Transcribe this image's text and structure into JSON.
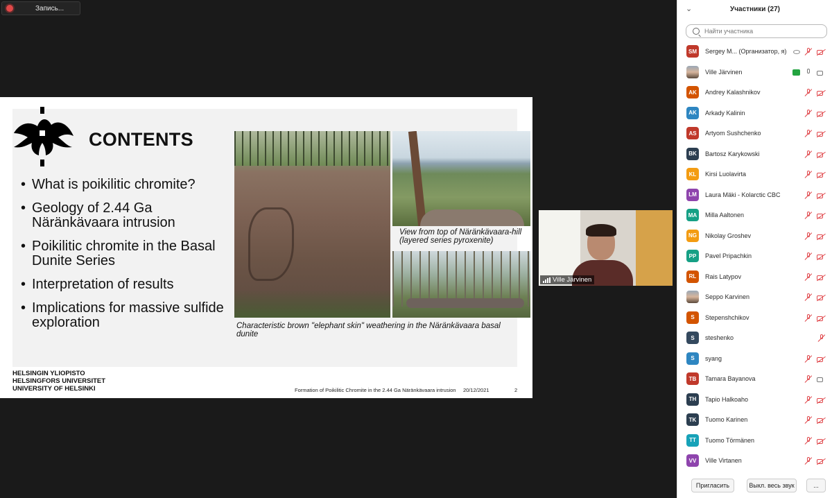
{
  "recording": {
    "label": "Запись..."
  },
  "slide": {
    "title": "CONTENTS",
    "bullets": [
      "What is poikilitic chromite?",
      "Geology of 2.44 Ga Näränkävaara intrusion",
      "Poikilitic chromite in the Basal Dunite Series",
      "Interpretation of results",
      "Implications for massive sulfide exploration"
    ],
    "caption_main": "Characteristic brown \"elephant skin\" weathering in the Näränkävaara basal dunite",
    "caption_view": "View from top of Näränkävaara-hill (layered series pyroxenite)",
    "university": [
      "HELSINGIN YLIOPISTO",
      "HELSINGFORS UNIVERSITET",
      "UNIVERSITY OF HELSINKI"
    ],
    "footer_title": "Formation of Poikilitic Chromite in the 2.44 Ga Näränkävaara intrusion",
    "footer_date": "20/12/2021",
    "footer_page": "2"
  },
  "video_tile": {
    "name": "Ville Järvinen"
  },
  "participants_panel": {
    "title": "Участники (27)",
    "search_placeholder": "Найти участника",
    "participants": [
      {
        "initials": "SM",
        "name": "Sergey M... (Организатор, я)",
        "color": "#c0392b",
        "mic": "off",
        "cam": "off",
        "eye": true
      },
      {
        "initials": "",
        "name": "Ville Järvinen",
        "photo": true,
        "mic": "on",
        "cam": "on",
        "share": true
      },
      {
        "initials": "AK",
        "name": "Andrey Kalashnikov",
        "color": "#d35400",
        "mic": "off",
        "cam": "off"
      },
      {
        "initials": "AK",
        "name": "Arkady Kalinin",
        "color": "#2e86c1",
        "mic": "off",
        "cam": "off"
      },
      {
        "initials": "AS",
        "name": "Artyom Sushchenko",
        "color": "#c0392b",
        "mic": "off",
        "cam": "off"
      },
      {
        "initials": "BK",
        "name": "Bartosz Karykowski",
        "color": "#2c3e50",
        "mic": "off",
        "cam": "off"
      },
      {
        "initials": "KL",
        "name": "Kirsi Luolavirta",
        "color": "#f39c12",
        "mic": "off",
        "cam": "off"
      },
      {
        "initials": "LM",
        "name": "Laura Mäki - Kolarctic CBC",
        "color": "#8e44ad",
        "mic": "off",
        "cam": "off"
      },
      {
        "initials": "MA",
        "name": "Milla Aaltonen",
        "color": "#16a085",
        "mic": "off",
        "cam": "off"
      },
      {
        "initials": "NG",
        "name": "Nikolay Groshev",
        "color": "#f39c12",
        "mic": "off",
        "cam": "off"
      },
      {
        "initials": "PP",
        "name": "Pavel Pripachkin",
        "color": "#16a085",
        "mic": "off",
        "cam": "off"
      },
      {
        "initials": "RL",
        "name": "Rais Latypov",
        "color": "#d35400",
        "mic": "off",
        "cam": "off"
      },
      {
        "initials": "",
        "name": "Seppo Karvinen",
        "photo": true,
        "mic": "off",
        "cam": "off"
      },
      {
        "initials": "S",
        "name": "Stepenshchikov",
        "color": "#d35400",
        "mic": "off",
        "cam": "off"
      },
      {
        "initials": "S",
        "name": "steshenko",
        "color": "#34495e",
        "mic": "off",
        "cam": "none"
      },
      {
        "initials": "S",
        "name": "syang",
        "color": "#2e86c1",
        "mic": "off",
        "cam": "off"
      },
      {
        "initials": "TB",
        "name": "Tamara Bayanova",
        "color": "#c0392b",
        "mic": "off",
        "cam": "on"
      },
      {
        "initials": "TH",
        "name": "Tapio Halkoaho",
        "color": "#2c3e50",
        "mic": "off",
        "cam": "off"
      },
      {
        "initials": "TK",
        "name": "Tuomo Karinen",
        "color": "#2c3e50",
        "mic": "off",
        "cam": "off"
      },
      {
        "initials": "TT",
        "name": "Tuomo Törmänen",
        "color": "#17a2b8",
        "mic": "off",
        "cam": "off"
      },
      {
        "initials": "VV",
        "name": "Ville Virtanen",
        "color": "#8e44ad",
        "mic": "off",
        "cam": "off"
      }
    ],
    "buttons": {
      "invite": "Пригласить",
      "mute_all": "Выкл. весь звук",
      "more": "..."
    }
  }
}
